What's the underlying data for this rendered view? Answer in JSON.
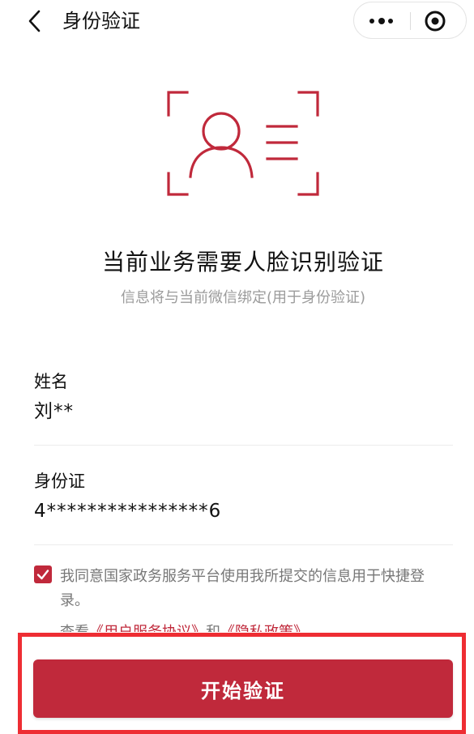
{
  "navbar": {
    "title": "身份验证",
    "back_icon": "chevron-left-icon",
    "more_icon": "more-dots-icon",
    "close_icon": "target-circle-icon"
  },
  "hero": {
    "icon": "face-scan-icon",
    "title": "当前业务需要人脸识别验证",
    "subtitle": "信息将与当前微信绑定(用于身份验证)"
  },
  "fields": [
    {
      "label": "姓名",
      "value": "刘**"
    },
    {
      "label": "身份证",
      "value": "4****************6"
    }
  ],
  "agreement": {
    "checked": true,
    "text": "我同意国家政务服务平台使用我所提交的信息用于快捷登录。",
    "view_prefix": "查看",
    "user_agreement": "《用户服务协议》",
    "joiner": "和",
    "privacy_policy": "《隐私政策》"
  },
  "action": {
    "start_label": "开始验证"
  },
  "colors": {
    "accent": "#c0293b",
    "highlight_border": "#ee2d33",
    "muted_text": "#9b9b9b"
  }
}
